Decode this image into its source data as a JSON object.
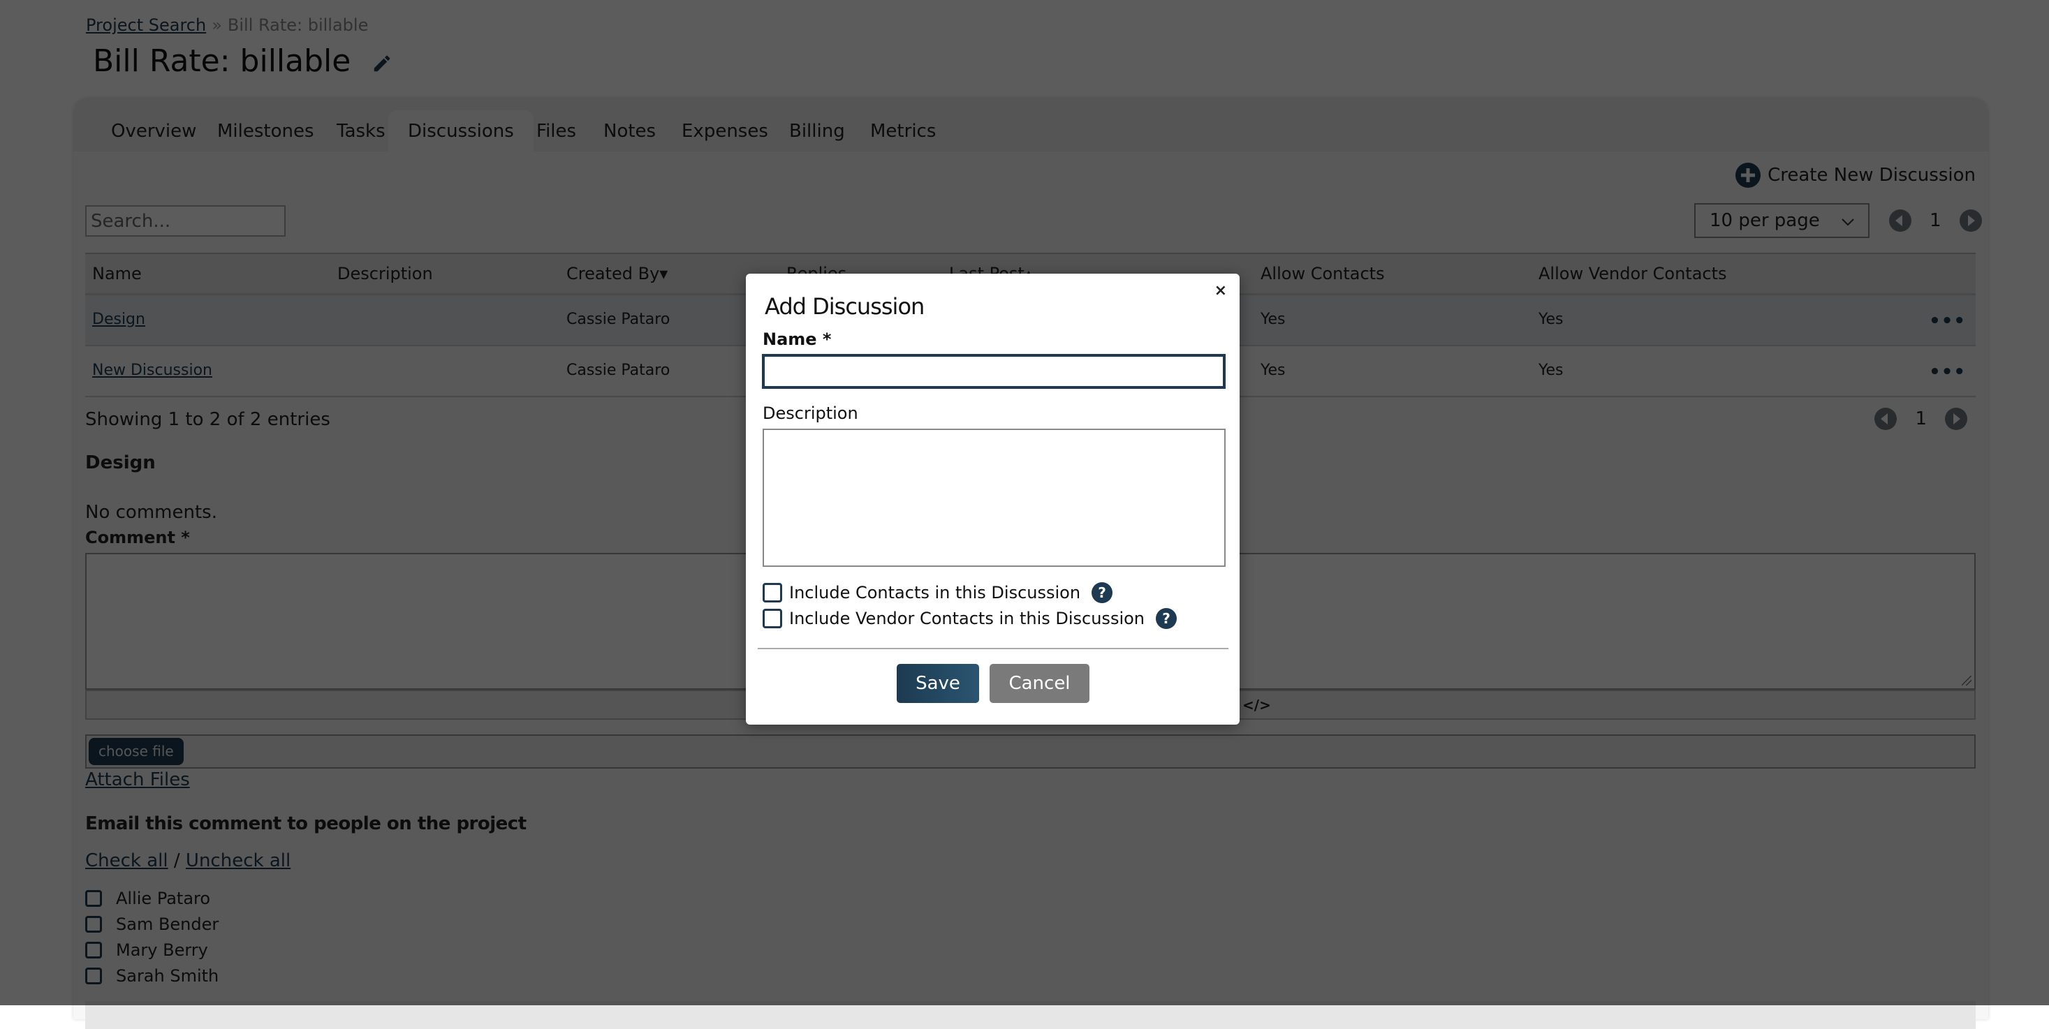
{
  "breadcrumb": {
    "link": "Project Search",
    "separator": "»",
    "current": "Bill Rate: billable"
  },
  "page_title": "Bill Rate: billable",
  "tabs": [
    {
      "label": "Overview",
      "active": false
    },
    {
      "label": "Milestones",
      "active": false
    },
    {
      "label": "Tasks",
      "active": false
    },
    {
      "label": "Discussions",
      "active": true
    },
    {
      "label": "Files",
      "active": false
    },
    {
      "label": "Notes",
      "active": false
    },
    {
      "label": "Expenses",
      "active": false
    },
    {
      "label": "Billing",
      "active": false
    },
    {
      "label": "Metrics",
      "active": false
    }
  ],
  "toolbar": {
    "create_label": "Create New Discussion",
    "search_placeholder": "Search...",
    "per_page": "10 per page",
    "page": "1"
  },
  "table": {
    "headers": [
      "Name",
      "Description",
      "Created By▾",
      "Replies",
      "Last Post▴",
      "Allow Contacts",
      "Allow Vendor Contacts"
    ],
    "rows": [
      {
        "name": "Design",
        "description": "",
        "created_by": "Cassie Pataro",
        "allow_contacts": "Yes",
        "allow_vendor_contacts": "Yes"
      },
      {
        "name": "New Discussion",
        "description": "",
        "created_by": "Cassie Pataro",
        "allow_contacts": "Yes",
        "allow_vendor_contacts": "Yes"
      }
    ],
    "row_menu": "•••"
  },
  "footer": {
    "showing": "Showing 1 to 2 of 2 entries",
    "page": "1"
  },
  "discussion": {
    "title": "Design",
    "no_comments": "No comments.",
    "comment_label": "Comment *",
    "code_icon": "</>",
    "choose_file": "choose file",
    "attach_files": "Attach Files",
    "email_heading": "Email this comment to people on the project",
    "check_all": "Check all",
    "slash": "/",
    "uncheck_all": "Uncheck all",
    "people": [
      "Allie Pataro",
      "Sam Bender",
      "Mary Berry",
      "Sarah Smith"
    ]
  },
  "modal": {
    "title": "Add Discussion",
    "close": "×",
    "name_label": "Name *",
    "name_value": "",
    "description_label": "Description",
    "description_value": "",
    "include_contacts": "Include Contacts in this Discussion",
    "include_vendor_contacts": "Include Vendor Contacts in this Discussion",
    "help": "?",
    "save": "Save",
    "cancel": "Cancel"
  },
  "colors": {
    "brand": "#1d3a52",
    "cancel": "#7a7a7a",
    "overlay": "rgba(0,0,0,0.64)"
  }
}
